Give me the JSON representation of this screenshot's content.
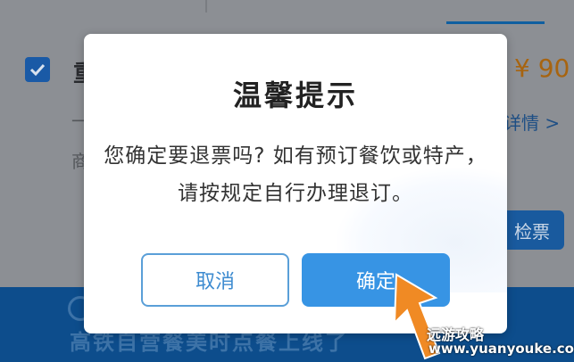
{
  "background": {
    "item_first_char": "重",
    "price": "¥ 90",
    "detail_link": "详情 >",
    "side_char_1": "一",
    "side_char_2": "商",
    "check_button": "检票",
    "banner_text": "高铁自营餐美时点餐上线了"
  },
  "dialog": {
    "title": "温馨提示",
    "message": "您确定要退票吗? 如有预订餐饮或特产，请按规定自行办理退订。",
    "cancel_label": "取消",
    "confirm_label": "确定"
  },
  "watermark": {
    "cn": "远游攻略",
    "url": "www.yuanyouke.com"
  },
  "colors": {
    "accent": "#3794e4",
    "cancel_border": "#5a9fd8",
    "arrow": "#f08a24"
  }
}
